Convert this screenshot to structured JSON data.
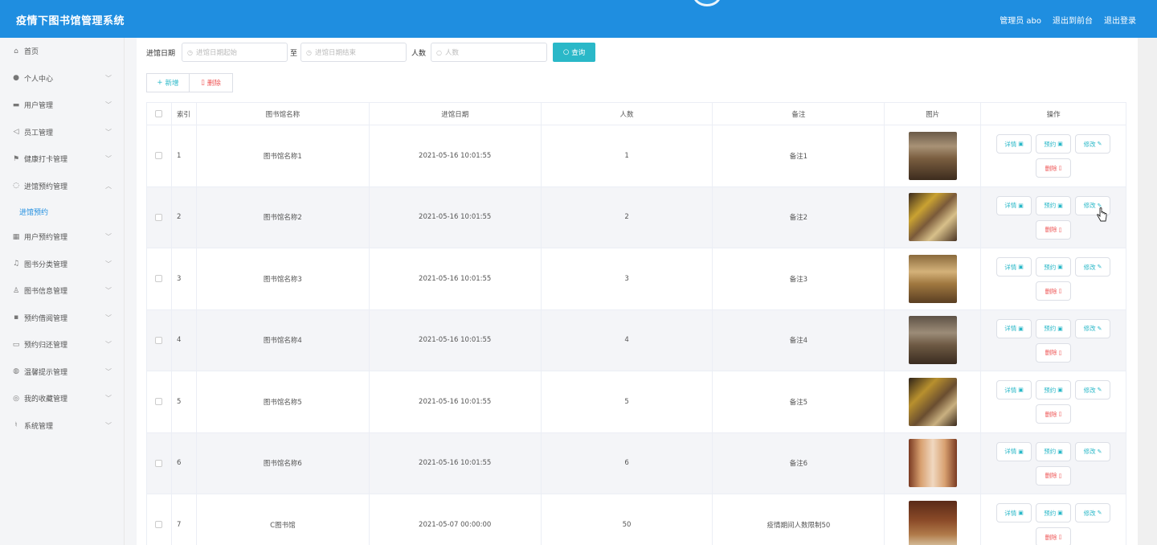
{
  "header": {
    "title": "疫情下图书馆管理系统",
    "admin": "管理员 abo",
    "exit_front": "退出到前台",
    "logout": "退出登录"
  },
  "sidebar": {
    "items": [
      {
        "label": "首页",
        "icon": "home-icon",
        "glyph": "⌂",
        "chevron": false
      },
      {
        "label": "个人中心",
        "icon": "user-icon",
        "glyph": "●",
        "chevron": true
      },
      {
        "label": "用户管理",
        "icon": "users-icon",
        "glyph": "▬",
        "chevron": true
      },
      {
        "label": "员工管理",
        "icon": "send-icon",
        "glyph": "◁",
        "chevron": true
      },
      {
        "label": "健康打卡管理",
        "icon": "flag-icon",
        "glyph": "⚑",
        "chevron": true
      },
      {
        "label": "进馆预约管理",
        "icon": "power-icon",
        "glyph": "◌",
        "chevron": true,
        "expanded": true
      }
    ],
    "sub_item": "进馆预约",
    "items_after": [
      {
        "label": "用户预约管理",
        "icon": "grid-icon",
        "glyph": "▦",
        "chevron": true
      },
      {
        "label": "图书分类管理",
        "icon": "bell-icon",
        "glyph": "♫",
        "chevron": true
      },
      {
        "label": "图书信息管理",
        "icon": "person-icon",
        "glyph": "♙",
        "chevron": true
      },
      {
        "label": "预约借阅管理",
        "icon": "apps-icon",
        "glyph": "▪",
        "chevron": true
      },
      {
        "label": "预约归还管理",
        "icon": "message-icon",
        "glyph": "▭",
        "chevron": true
      },
      {
        "label": "温馨提示管理",
        "icon": "circle-icon",
        "glyph": "◍",
        "chevron": true
      },
      {
        "label": "我的收藏管理",
        "icon": "compass-icon",
        "glyph": "◎",
        "chevron": true
      },
      {
        "label": "系统管理",
        "icon": "mic-icon",
        "glyph": "♮",
        "chevron": true
      }
    ]
  },
  "search": {
    "date_label": "进馆日期",
    "start_placeholder": "进馆日期起始",
    "to_label": "至",
    "end_placeholder": "进馆日期结束",
    "count_label": "人数",
    "count_placeholder": "人数",
    "query_button": "查询"
  },
  "toolbar": {
    "add_label": "新增",
    "delete_label": "删除"
  },
  "table": {
    "columns": [
      "索引",
      "图书馆名称",
      "进馆日期",
      "人数",
      "备注",
      "图片",
      "操作"
    ],
    "rows": [
      {
        "index": "1",
        "name": "图书馆名称1",
        "date": "2021-05-16 10:01:55",
        "count": "1",
        "note": "备注1"
      },
      {
        "index": "2",
        "name": "图书馆名称2",
        "date": "2021-05-16 10:01:55",
        "count": "2",
        "note": "备注2"
      },
      {
        "index": "3",
        "name": "图书馆名称3",
        "date": "2021-05-16 10:01:55",
        "count": "3",
        "note": "备注3"
      },
      {
        "index": "4",
        "name": "图书馆名称4",
        "date": "2021-05-16 10:01:55",
        "count": "4",
        "note": "备注4"
      },
      {
        "index": "5",
        "name": "图书馆名称5",
        "date": "2021-05-16 10:01:55",
        "count": "5",
        "note": "备注5"
      },
      {
        "index": "6",
        "name": "图书馆名称6",
        "date": "2021-05-16 10:01:55",
        "count": "6",
        "note": "备注6"
      },
      {
        "index": "7",
        "name": "C图书馆",
        "date": "2021-05-07 00:00:00",
        "count": "50",
        "note": "疫情期间人数限制50"
      }
    ],
    "actions": {
      "detail": "详情",
      "reserve": "预约",
      "edit": "修改",
      "delete": "删除"
    }
  },
  "colors": {
    "header_blue": "#1f8ee0",
    "accent_teal": "#2ab8c8",
    "danger_red": "#e55555"
  }
}
